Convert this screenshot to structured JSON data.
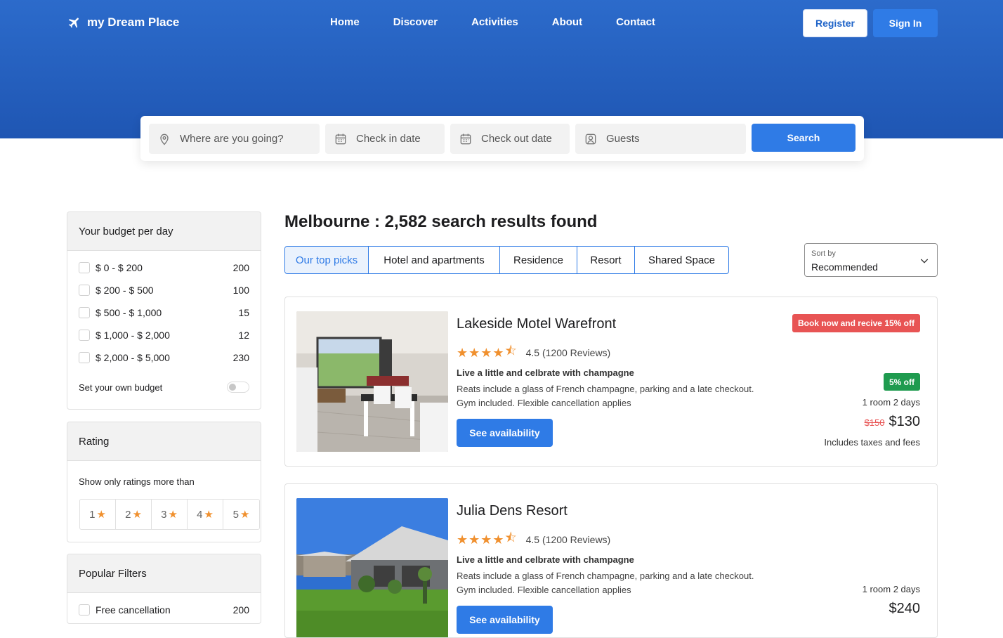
{
  "header": {
    "brand": "my Dream Place",
    "nav": [
      "Home",
      "Discover",
      "Activities",
      "About",
      "Contact"
    ],
    "register_label": "Register",
    "signin_label": "Sign In"
  },
  "search": {
    "destination_placeholder": "Where are you going?",
    "checkin_placeholder": "Check in date",
    "checkout_placeholder": "Check out date",
    "guests_placeholder": "Guests",
    "button_label": "Search"
  },
  "sidebar": {
    "budget": {
      "title": "Your budget per day",
      "options": [
        {
          "label": "$ 0 - $ 200",
          "count": "200"
        },
        {
          "label": "$ 200 - $ 500",
          "count": "100"
        },
        {
          "label": "$ 500 - $ 1,000",
          "count": "15"
        },
        {
          "label": "$ 1,000 - $ 2,000",
          "count": "12"
        },
        {
          "label": "$ 2,000 - $ 5,000",
          "count": "230"
        }
      ],
      "own_budget_label": "Set your own budget",
      "own_budget_enabled": false
    },
    "rating": {
      "title": "Rating",
      "subtitle": "Show only ratings more than",
      "options": [
        "1",
        "2",
        "3",
        "4",
        "5"
      ]
    },
    "popular": {
      "title": "Popular Filters",
      "options": [
        {
          "label": "Free cancellation",
          "count": "200"
        }
      ]
    }
  },
  "results": {
    "title": "Melbourne : 2,582 search results found",
    "tabs": [
      "Our top picks",
      "Hotel and apartments",
      "Residence",
      "Resort",
      "Shared Space"
    ],
    "active_tab": "Our top picks",
    "sort_label": "Sort by",
    "sort_value": "Recommended",
    "listings": [
      {
        "name": "Lakeside Motel Warefront",
        "rating": 4.5,
        "rating_text": "4.5 (1200 Reviews)",
        "tagline": "Live a little and celbrate with champagne",
        "desc1": "Reats include a glass of French champagne, parking and a late checkout.",
        "desc2": "Gym included. Flexible cancellation applies",
        "cta": "See availability",
        "promo": "Book now and recive 15% off",
        "discount": "5% off",
        "stay": "1 room 2 days",
        "old_price": "$150",
        "price": "$130",
        "taxes": "Includes taxes and fees"
      },
      {
        "name": "Julia Dens Resort",
        "rating": 4.5,
        "rating_text": "4.5 (1200 Reviews)",
        "tagline": "Live a little and celbrate with champagne",
        "desc1": "Reats include a glass of French champagne, parking and a late checkout.",
        "desc2": "Gym included. Flexible cancellation applies",
        "cta": "See availability",
        "stay": "1 room 2 days",
        "price": "$240"
      }
    ]
  },
  "colors": {
    "brand_blue": "#2f7be6",
    "header_blue": "#1f56b3",
    "promo_red": "#e85454",
    "discount_green": "#1f9b4f",
    "star_orange": "#f0902e"
  }
}
